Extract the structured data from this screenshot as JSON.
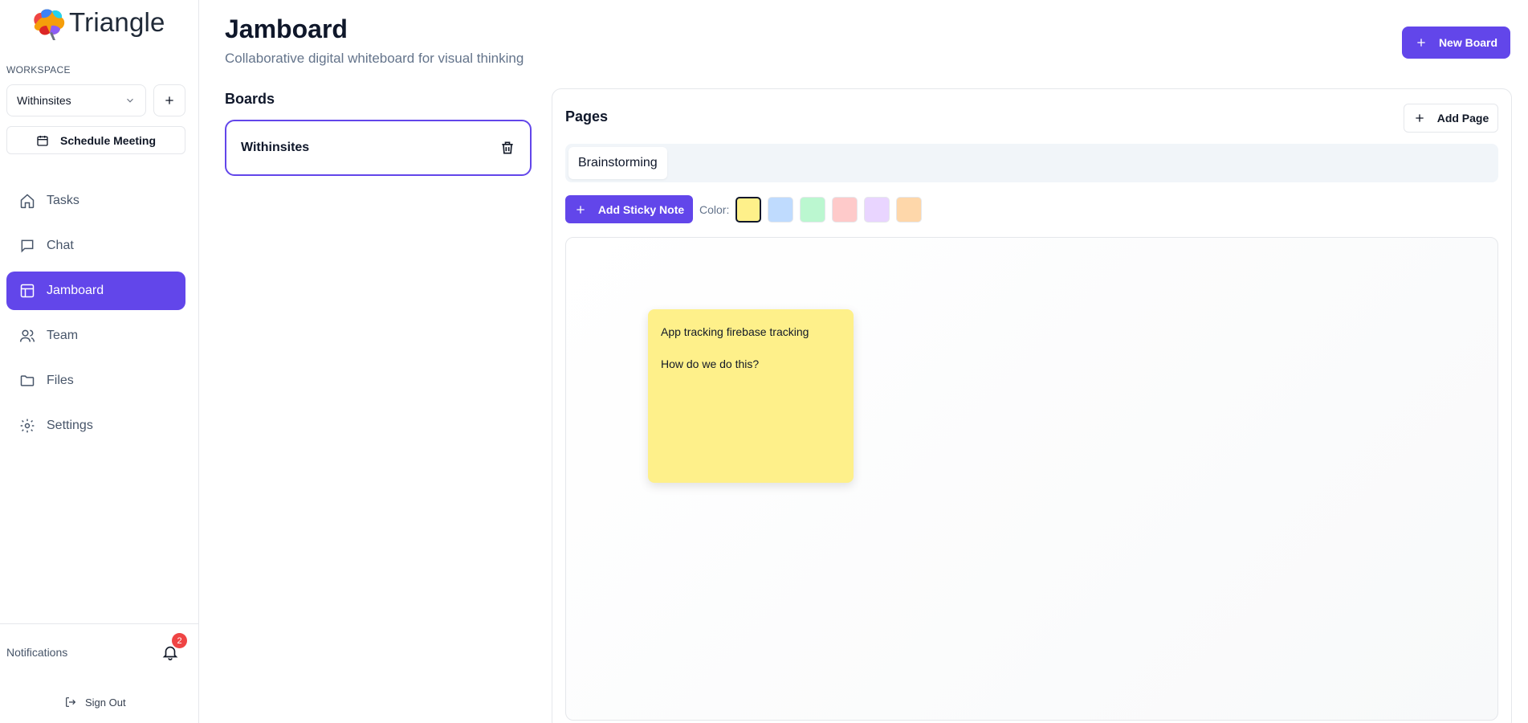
{
  "app": {
    "name": "Triangle"
  },
  "sidebar": {
    "workspace_label": "WORKSPACE",
    "workspace_selected": "Withinsites",
    "schedule_label": "Schedule Meeting",
    "items": [
      {
        "label": "Tasks",
        "icon": "home-icon"
      },
      {
        "label": "Chat",
        "icon": "chat-icon"
      },
      {
        "label": "Jamboard",
        "icon": "layout-icon",
        "active": true
      },
      {
        "label": "Team",
        "icon": "users-icon"
      },
      {
        "label": "Files",
        "icon": "folder-icon"
      },
      {
        "label": "Settings",
        "icon": "gear-icon"
      }
    ],
    "notifications_label": "Notifications",
    "notifications_count": "2",
    "signout_label": "Sign Out"
  },
  "header": {
    "title": "Jamboard",
    "subtitle": "Collaborative digital whiteboard for visual thinking",
    "new_board_label": "New Board"
  },
  "boards": {
    "title": "Boards",
    "items": [
      {
        "name": "Withinsites"
      }
    ]
  },
  "pages": {
    "title": "Pages",
    "add_page_label": "Add Page",
    "tabs": [
      {
        "label": "Brainstorming"
      }
    ],
    "add_note_label": "Add Sticky Note",
    "color_label": "Color:",
    "colors": [
      "#fef08a",
      "#bfdbfe",
      "#bbf7d0",
      "#fecaca",
      "#e9d5ff",
      "#fed7aa"
    ],
    "selected_color": "#fef08a"
  },
  "notes": [
    {
      "line1": "App tracking firebase tracking",
      "line2": "How do we do this?",
      "color": "#fef08a"
    }
  ],
  "theme": {
    "accent": "#6246ea",
    "danger": "#ef4444"
  }
}
